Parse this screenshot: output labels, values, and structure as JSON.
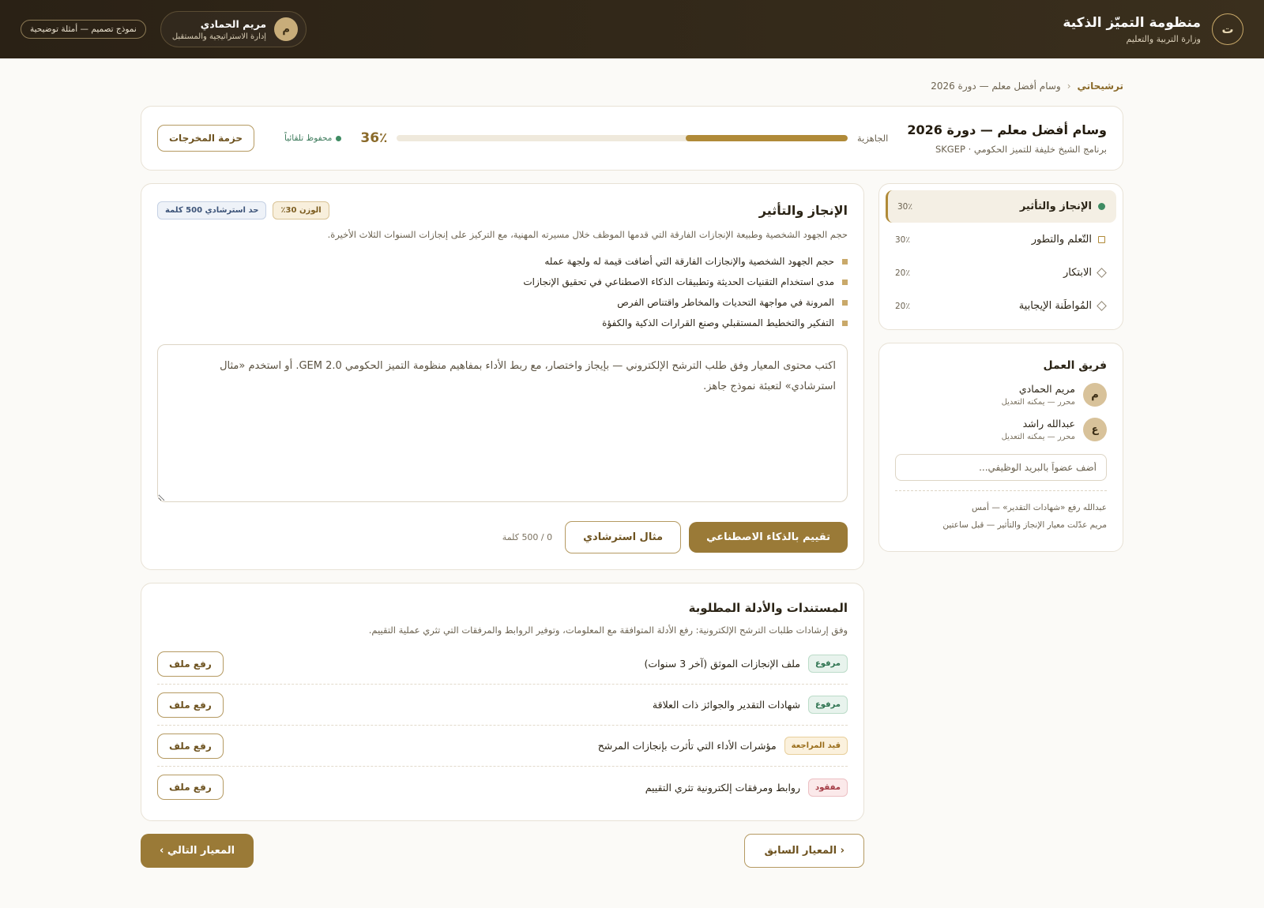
{
  "header": {
    "logo_letter": "ت",
    "title": "منظومة التميّز الذكية",
    "subtitle": "وزارة التربية والتعليم",
    "demo_pill": "نموذج تصميم — أمثلة توضيحية",
    "user": {
      "initial": "م",
      "name": "مريم الحمادي",
      "role": "إدارة الاستراتيجية والمستقبل"
    }
  },
  "breadcrumb": {
    "root": "ترشيحاتي",
    "separator": "‹",
    "current": "وسام أفضل معلم — دورة 2026"
  },
  "hero": {
    "title": "وسام أفضل معلم — دورة 2026",
    "subtitle": "برنامج الشيخ خليفة للتميز الحكومي · SKGEP",
    "readiness_label": "الجاهزية",
    "readiness_value": 36,
    "readiness_text": "36٪",
    "saved_text": "محفوظ تلقائياً",
    "package_button": "حزمة المخرجات"
  },
  "criteria": [
    {
      "name": "الإنجاز والتأثير",
      "weight": "30٪",
      "icon": "dot-icon",
      "active": true
    },
    {
      "name": "التّعلم والتطور",
      "weight": "30٪",
      "icon": "square-icon",
      "active": false
    },
    {
      "name": "الابتكار",
      "weight": "20٪",
      "icon": "diamond-icon",
      "active": false
    },
    {
      "name": "المُواطَنة الإيجابية",
      "weight": "20٪",
      "icon": "diamond-icon",
      "active": false
    }
  ],
  "team": {
    "title": "فريق العمل",
    "members": [
      {
        "initial": "م",
        "name": "مريم الحمادي",
        "role": "محرر — يمكنه التعديل"
      },
      {
        "initial": "ع",
        "name": "عبدالله راشد",
        "role": "محرر — يمكنه التعديل"
      }
    ],
    "invite_placeholder": "أضف عضواً بالبريد الوظيفي...",
    "activity": [
      "عبدالله رفع «شهادات التقدير» — أمس",
      "مريم عدّلت معيار الإنجاز والتأثير — قبل ساعتين"
    ]
  },
  "criterion": {
    "title": "الإنجاز والتأثير",
    "weight_tag": "الوزن 30٪",
    "limit_tag": "حد استرشادي 500 كلمة",
    "description": "حجم الجهود الشخصية وطبيعة الإنجازات الفارقة التي قدمها الموظف خلال مسيرته المهنية، مع التركيز على إنجازات السنوات الثلاث الأخيرة.",
    "points": [
      "حجم الجهود الشخصية والإنجازات الفارقة التي أضافت قيمة له ولجهة عمله",
      "مدى استخدام التقنيات الحديثة وتطبيقات الذكاء الاصطناعي في تحقيق الإنجازات",
      "المرونة في مواجهة التحديات والمخاطر واقتناص الفرص",
      "التفكير والتخطيط المستقبلي وصنع القرارات الذكية والكفؤة"
    ],
    "editor_placeholder": "اكتب محتوى المعيار وفق طلب الترشح الإلكتروني — بإيجاز واختصار، مع ربط الأداء بمفاهيم منظومة التميز الحكومي GEM 2.0. أو استخدم «مثال استرشادي» لتعبئة نموذج جاهز.",
    "ai_button": "تقييم بالذكاء الاصطناعي",
    "example_button": "مثال استرشادي",
    "word_count": "0 / 500 كلمة"
  },
  "documents": {
    "title": "المستندات والأدلة المطلوبة",
    "description": "وفق إرشادات طلبات الترشح الإلكترونية: رفع الأدلة المتوافقة مع المعلومات، وتوفير الروابط والمرفقات التي تثري عملية التقييم.",
    "upload_label": "رفع ملف",
    "items": [
      {
        "name": "ملف الإنجازات الموثق (آخر 3 سنوات)",
        "status": "مرفوع",
        "status_type": "uploaded"
      },
      {
        "name": "شهادات التقدير والجوائز ذات العلاقة",
        "status": "مرفوع",
        "status_type": "uploaded"
      },
      {
        "name": "مؤشرات الأداء التي تأثرت بإنجازات المرشح",
        "status": "قيد المراجعة",
        "status_type": "review"
      },
      {
        "name": "روابط ومرفقات إلكترونية تثري التقييم",
        "status": "مفقود",
        "status_type": "missing"
      }
    ]
  },
  "pager": {
    "prev": "‹ المعيار السابق",
    "next": "المعيار التالي ›"
  }
}
